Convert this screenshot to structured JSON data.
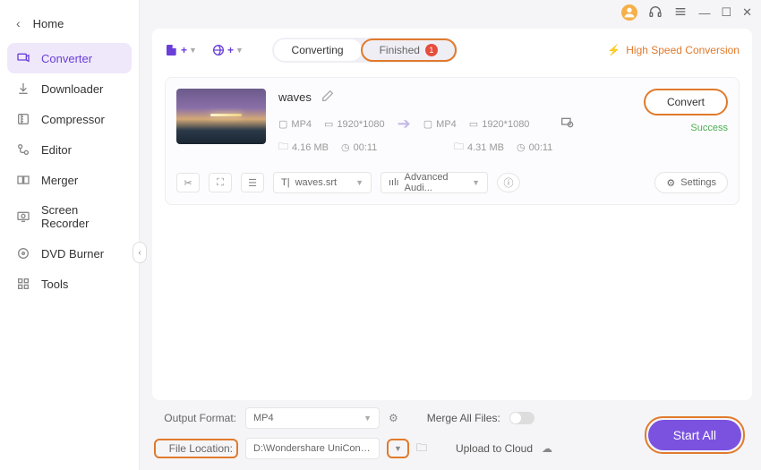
{
  "sidebar": {
    "back_label": "Home",
    "items": [
      {
        "label": "Converter",
        "icon": "converter-icon"
      },
      {
        "label": "Downloader",
        "icon": "downloader-icon"
      },
      {
        "label": "Compressor",
        "icon": "compressor-icon"
      },
      {
        "label": "Editor",
        "icon": "editor-icon"
      },
      {
        "label": "Merger",
        "icon": "merger-icon"
      },
      {
        "label": "Screen Recorder",
        "icon": "screenrecorder-icon"
      },
      {
        "label": "DVD Burner",
        "icon": "dvdburner-icon"
      },
      {
        "label": "Tools",
        "icon": "tools-icon"
      }
    ]
  },
  "tabs": {
    "converting": "Converting",
    "finished": "Finished",
    "finished_badge": "1"
  },
  "highspeed": "High Speed Conversion",
  "item": {
    "name": "waves",
    "src": {
      "format": "MP4",
      "resolution": "1920*1080",
      "size": "4.16 MB",
      "duration": "00:11"
    },
    "dst": {
      "format": "MP4",
      "resolution": "1920*1080",
      "size": "4.31 MB",
      "duration": "00:11"
    },
    "convert_label": "Convert",
    "status": "Success",
    "subtitle_file": "waves.srt",
    "audio_dd": "Advanced Audi...",
    "settings_label": "Settings"
  },
  "footer": {
    "output_format_label": "Output Format:",
    "output_format_value": "MP4",
    "merge_label": "Merge All Files:",
    "file_location_label": "File Location:",
    "file_location_value": "D:\\Wondershare UniConverter 1",
    "upload_label": "Upload to Cloud",
    "start_all": "Start All"
  }
}
